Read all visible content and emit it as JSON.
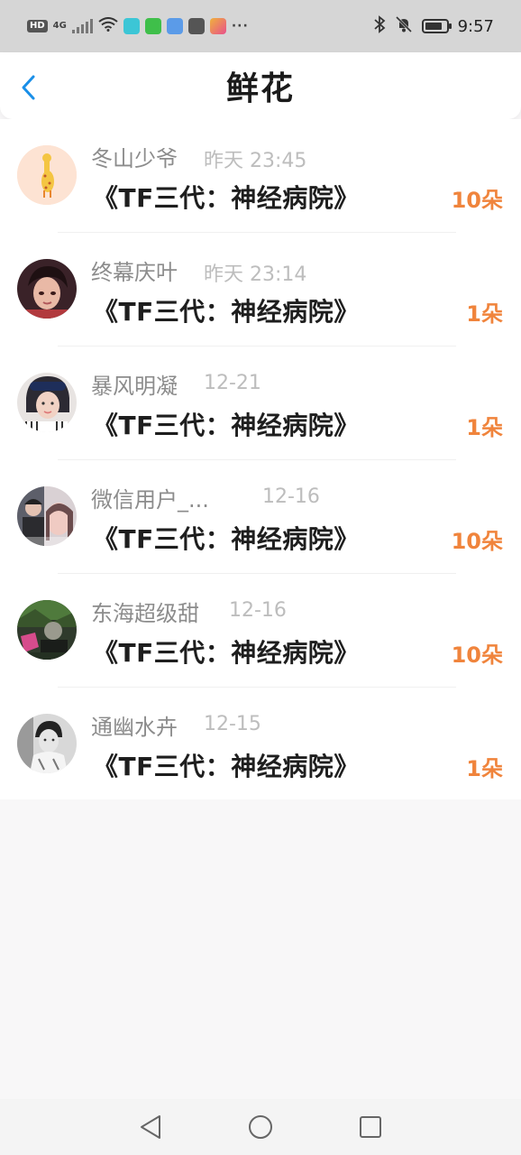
{
  "status_bar": {
    "hd_badge": "HD",
    "network": "4G",
    "time": "9:57",
    "dots": "···",
    "battery_level": 0.85
  },
  "header": {
    "title": "鲜花"
  },
  "colors": {
    "accent_back": "#1a8fe8",
    "count_color": "#f0843c",
    "username_color": "#8c8c8c",
    "time_color": "#bdbdbd"
  },
  "items": [
    {
      "username": "冬山少爷",
      "time": "昨天 23:45",
      "work": "《TF三代：神经病院》",
      "count": "10朵",
      "avatar": "giraffe-cartoon-avatar"
    },
    {
      "username": "终幕庆叶",
      "time": "昨天 23:14",
      "work": "《TF三代：神经病院》",
      "count": "1朵",
      "avatar": "illustrated-character-avatar"
    },
    {
      "username": "暴风明凝",
      "time": "12-21",
      "work": "《TF三代：神经病院》",
      "count": "1朵",
      "avatar": "girl-photo-avatar"
    },
    {
      "username": "微信用户_...",
      "time": "12-16",
      "work": "《TF三代：神经病院》",
      "count": "10朵",
      "avatar": "couple-photo-avatar"
    },
    {
      "username": "东海超级甜",
      "time": "12-16",
      "work": "《TF三代：神经病院》",
      "count": "10朵",
      "avatar": "green-tint-photo-avatar"
    },
    {
      "username": "通幽水卉",
      "time": "12-15",
      "work": "《TF三代：神经病院》",
      "count": "1朵",
      "avatar": "grayscale-photo-avatar"
    }
  ]
}
